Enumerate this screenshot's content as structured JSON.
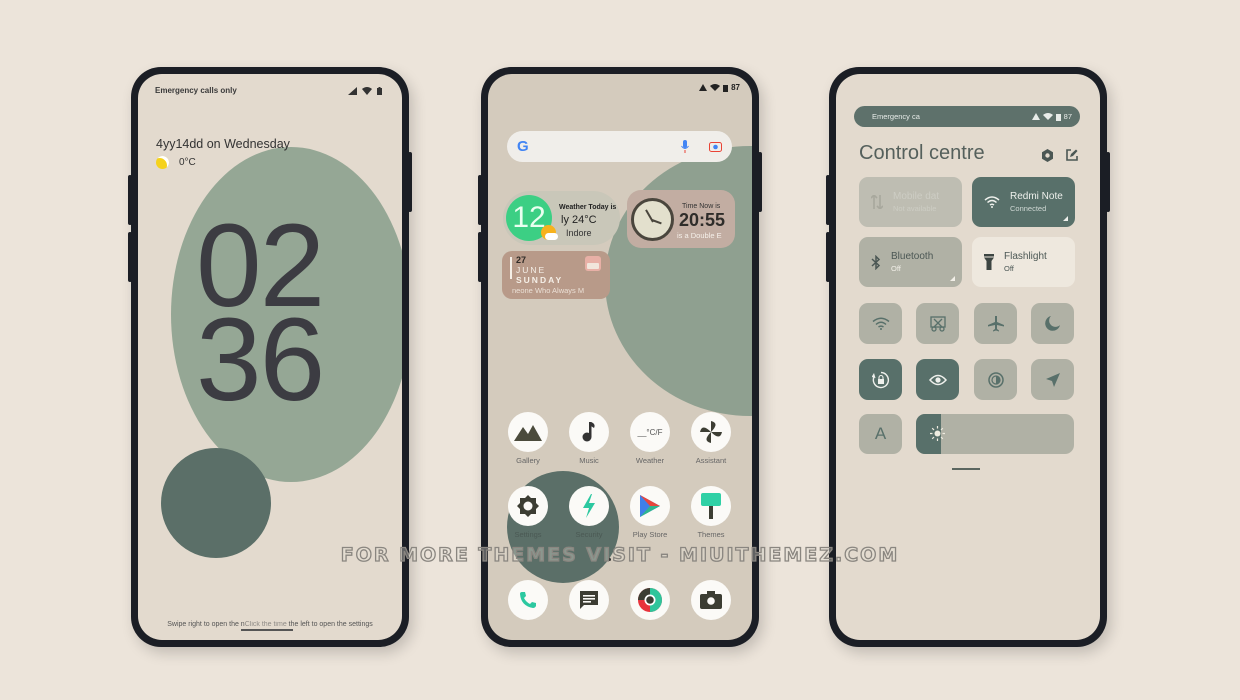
{
  "lockscreen": {
    "status_text": "Emergency calls only",
    "date_line": "4yy14dd on Wednesday",
    "weather_temp": "0°C",
    "clock_hours": "02",
    "clock_minutes": "36",
    "hint_text": "Swipe right to open the n",
    "hint_overlap": "Click the time",
    "hint_tail": "the left to open the settings"
  },
  "homescreen": {
    "battery": "87",
    "search": {
      "logo": "G",
      "placeholder": ""
    },
    "weather_widget": {
      "icon_number": "12",
      "title": "Weather Today is",
      "temp": "ly  24°C",
      "city": "Indore"
    },
    "clock_widget": {
      "title": "Time Now is",
      "time": "20:55",
      "subtitle": "is a Double E"
    },
    "calendar_widget": {
      "day": "27",
      "month": "JUNE",
      "weekday": "SUNDAY",
      "subtitle": "neone Who Always M"
    },
    "apps_row1": [
      {
        "label": "Gallery",
        "icon": "mountain-icon"
      },
      {
        "label": "Music",
        "icon": "music-note-icon"
      },
      {
        "label": "Weather",
        "icon": "weather-cf-icon",
        "glyph": "__°C/F"
      },
      {
        "label": "Assistant",
        "icon": "pinwheel-icon"
      }
    ],
    "apps_row2": [
      {
        "label": "Settings",
        "icon": "gear-icon"
      },
      {
        "label": "Security",
        "icon": "lightning-icon"
      },
      {
        "label": "Play Store",
        "icon": "play-store-icon"
      },
      {
        "label": "Themes",
        "icon": "paint-brush-icon"
      }
    ],
    "dock": [
      {
        "label": "Phone",
        "icon": "phone-icon"
      },
      {
        "label": "Messages",
        "icon": "message-icon"
      },
      {
        "label": "Browser",
        "icon": "browser-icon"
      },
      {
        "label": "Camera",
        "icon": "camera-icon"
      }
    ]
  },
  "control_centre": {
    "status_text": "Emergency ca",
    "battery": "87",
    "title": "Control centre",
    "tiles": [
      {
        "title": "Mobile dat",
        "subtitle": "Not available",
        "icon": "mobile-data-icon",
        "state": "disabled"
      },
      {
        "title": "Redmi Note",
        "subtitle": "Connected",
        "icon": "wifi-icon",
        "state": "on"
      },
      {
        "title": "Bluetooth",
        "subtitle": "Off",
        "icon": "bluetooth-icon",
        "state": "off"
      },
      {
        "title": "Flashlight",
        "subtitle": "Off",
        "icon": "flashlight-icon",
        "state": "off-light"
      }
    ],
    "toggles": [
      {
        "name": "hotspot-toggle",
        "icon": "hotspot-icon",
        "active": false
      },
      {
        "name": "screenshot-toggle",
        "icon": "scissors-icon",
        "active": false
      },
      {
        "name": "airplane-toggle",
        "icon": "airplane-icon",
        "active": false
      },
      {
        "name": "dark-mode-toggle",
        "icon": "moon-icon",
        "active": false
      },
      {
        "name": "rotation-lock-toggle",
        "icon": "rotation-lock-icon",
        "active": true
      },
      {
        "name": "reading-mode-toggle",
        "icon": "eye-icon",
        "active": true
      },
      {
        "name": "contrast-toggle",
        "icon": "contrast-icon",
        "active": false
      },
      {
        "name": "location-toggle",
        "icon": "location-icon",
        "active": false
      }
    ],
    "auto_brightness_label": "A",
    "brightness_level": 0.16
  },
  "watermark": "FOR MORE THEMES VISIT - MIUITHEMEZ.COM",
  "colors": {
    "sage": "#95a795",
    "dark_teal": "#5b6f68",
    "cream": "#e3dace",
    "tile_gray": "#b0b1a5"
  }
}
